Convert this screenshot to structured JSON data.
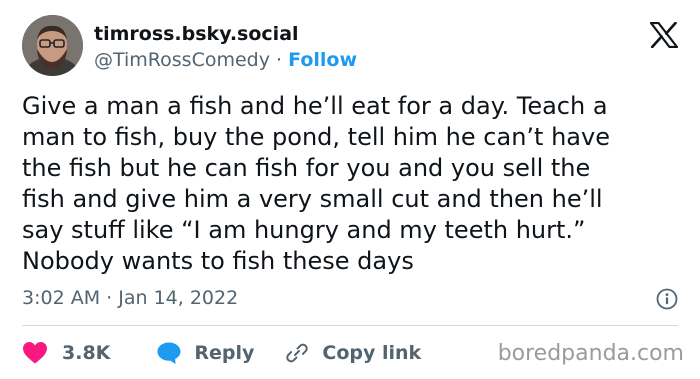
{
  "header": {
    "display_name": "timross.bsky.social",
    "handle": "@TimRossComedy",
    "separator": "·",
    "follow_label": "Follow"
  },
  "tweet": {
    "lines": [
      "Give a man a fish and he’ll eat for a day. Teach a",
      "man to fish, buy the pond, tell him he can’t have",
      "the fish but he can fish for you and you sell the",
      "fish and give him a very small cut and then he’ll",
      "say stuff like “I am hungry and my teeth hurt.”",
      "Nobody wants to fish these days"
    ],
    "time": "3:02 AM",
    "separator": "·",
    "date": "Jan 14, 2022"
  },
  "actions": {
    "like_count": "3.8K",
    "reply_label": "Reply",
    "copy_link_label": "Copy link"
  },
  "watermark": "boredpanda.com",
  "icons": {
    "brand": "x-logo-icon",
    "info": "info-icon",
    "like": "heart-icon",
    "reply": "speech-bubble-icon",
    "copy": "link-icon"
  },
  "colors": {
    "text": "#0f1419",
    "secondary": "#536471",
    "accent": "#1d9bf0",
    "like": "#f91880",
    "divider": "#cfd9de"
  }
}
